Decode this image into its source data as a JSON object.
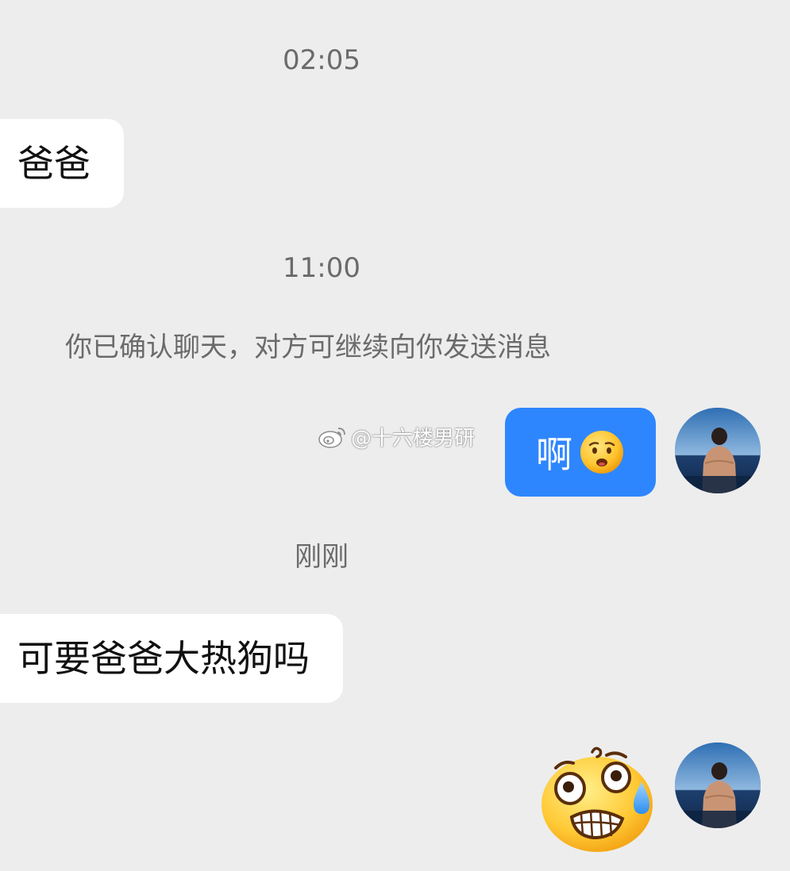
{
  "timestamps": {
    "first": "02:05",
    "second": "11:00",
    "third": "刚刚"
  },
  "system_notice": "你已确认聊天，对方可继续向你发送消息",
  "messages": {
    "incoming_1": "爸爸",
    "outgoing_1": "啊",
    "outgoing_1_emoji": "worried-face-emoji",
    "incoming_2": "可要爸爸大热狗吗",
    "outgoing_2_emoji": "anxious-grimace-sweat-emoji"
  },
  "watermark": {
    "text": "@十六楼男研",
    "icon": "weibo-logo-icon"
  },
  "colors": {
    "background": "#ededed",
    "incoming_bubble": "#ffffff",
    "outgoing_bubble": "#2e86ff",
    "timestamp_text": "#6b6b6b"
  }
}
